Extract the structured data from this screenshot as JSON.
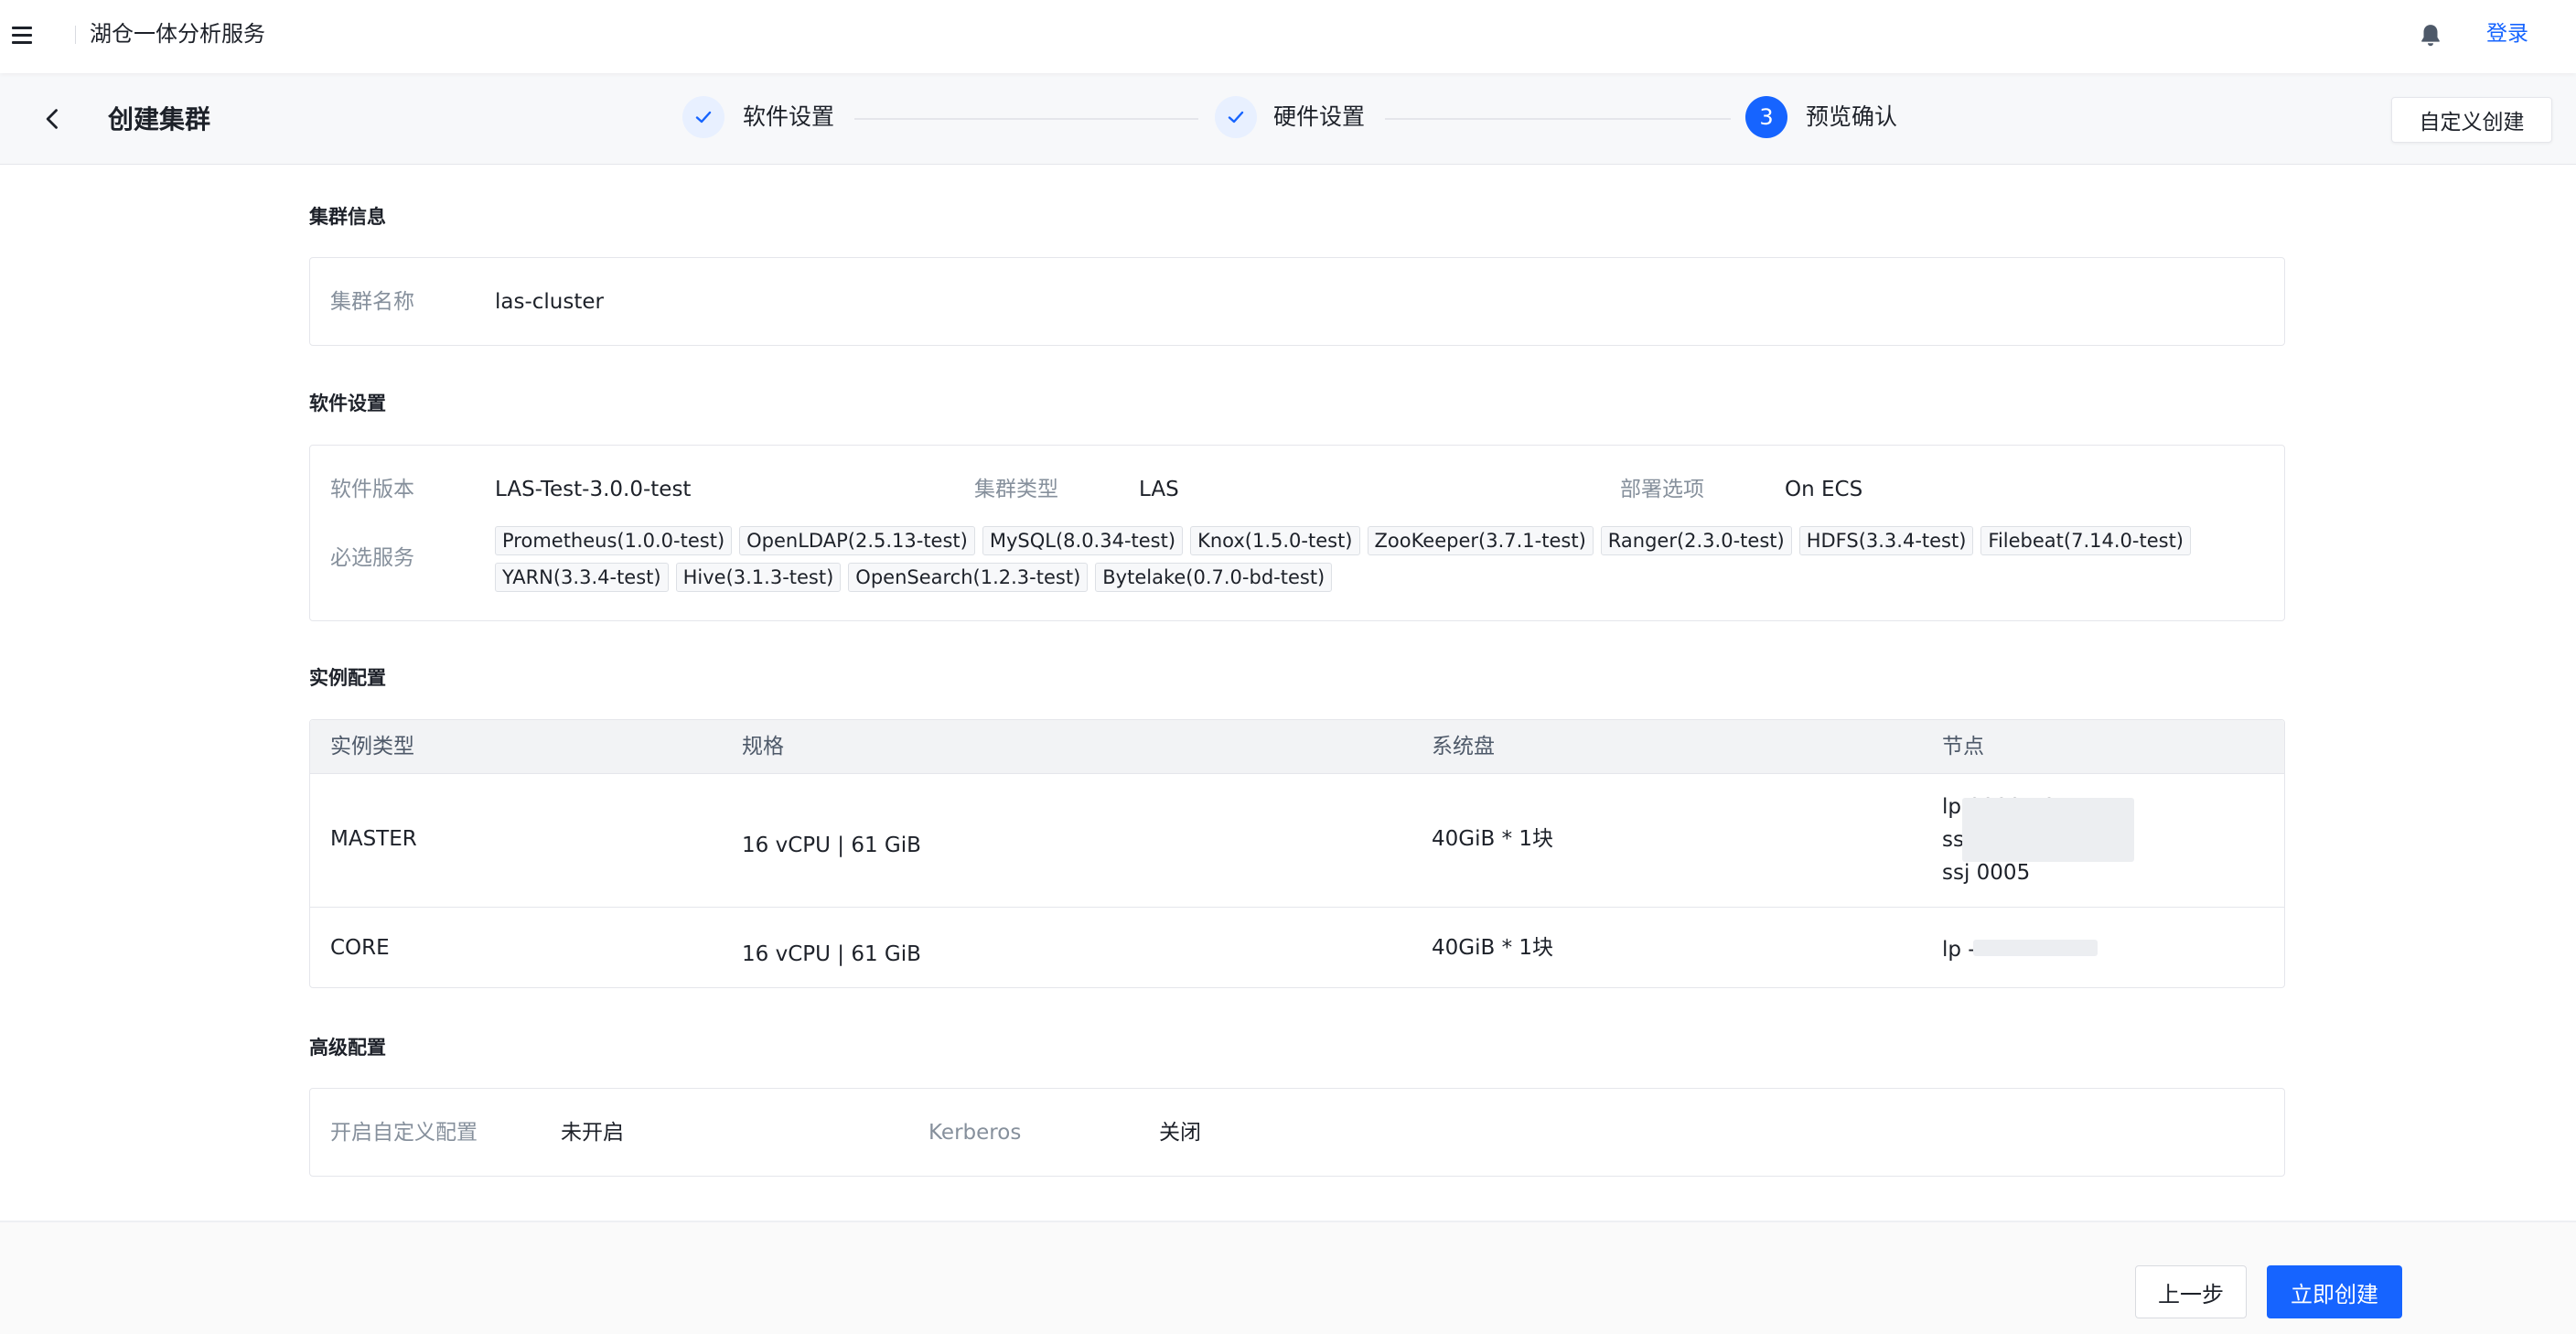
{
  "topbar": {
    "app_title": "湖仓一体分析服务",
    "login": "登录",
    "menu_icon": "hamburger-menu-icon",
    "bell_icon": "bell-icon"
  },
  "header": {
    "page_title": "创建集群",
    "custom_create": "自定义创建",
    "steps": [
      {
        "label": "软件设置",
        "status": "done"
      },
      {
        "label": "硬件设置",
        "status": "done"
      },
      {
        "label": "预览确认",
        "status": "active",
        "number": "3"
      }
    ]
  },
  "cluster_info": {
    "title": "集群信息",
    "name_label": "集群名称",
    "name_value": "las-cluster"
  },
  "software": {
    "title": "软件设置",
    "version_label": "软件版本",
    "version_value": "LAS-Test-3.0.0-test",
    "type_label": "集群类型",
    "type_value": "LAS",
    "deploy_label": "部署选项",
    "deploy_value": "On ECS",
    "services_label": "必选服务",
    "services": [
      "Prometheus(1.0.0-test)",
      "OpenLDAP(2.5.13-test)",
      "MySQL(8.0.34-test)",
      "Knox(1.5.0-test)",
      "ZooKeeper(3.7.1-test)",
      "Ranger(2.3.0-test)",
      "HDFS(3.3.4-test)",
      "Filebeat(7.14.0-test)",
      "YARN(3.3.4-test)",
      "Hive(3.1.3-test)",
      "OpenSearch(1.2.3-test)",
      "Bytelake(0.7.0-bd-test)"
    ]
  },
  "instances": {
    "title": "实例配置",
    "columns": [
      "实例类型",
      "规格",
      "系统盘",
      "节点"
    ],
    "rows": [
      {
        "type": "MASTER",
        "spec": "16 vCPU | 61 GiB",
        "disk": "40GiB * 1块",
        "nodes": [
          "lp          0000-10",
          "ss                     0007",
          "ssj            0005"
        ]
      },
      {
        "type": "CORE",
        "spec": "16 vCPU | 61 GiB",
        "disk": "40GiB * 1块",
        "nodes": [
          "lp                  -2"
        ]
      }
    ]
  },
  "advanced": {
    "title": "高级配置",
    "custom_config_label": "开启自定义配置",
    "custom_config_value": "未开启",
    "kerberos_label": "Kerberos",
    "kerberos_value": "关闭"
  },
  "footer": {
    "prev": "上一步",
    "create": "立即创建"
  },
  "colors": {
    "primary": "#1664ff",
    "step_done_bg": "#e8f0ff",
    "header_bg": "#f7f8fa"
  }
}
